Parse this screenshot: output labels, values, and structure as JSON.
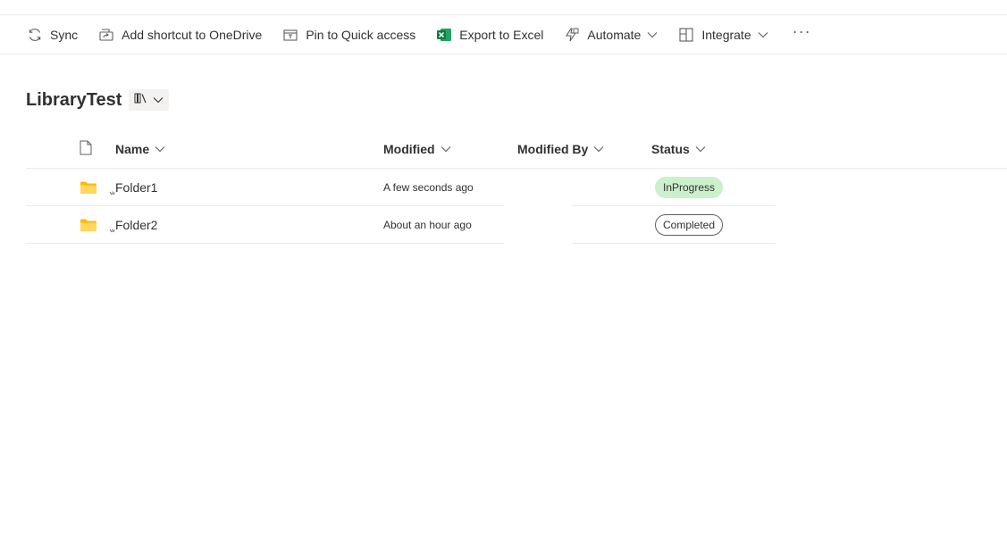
{
  "commandbar": {
    "sync": "Sync",
    "add_shortcut": "Add shortcut to OneDrive",
    "pin": "Pin to Quick access",
    "export": "Export to Excel",
    "automate": "Automate",
    "integrate": "Integrate",
    "more": "···"
  },
  "library": {
    "title": "LibraryTest"
  },
  "columns": {
    "name": "Name",
    "modified": "Modified",
    "modified_by": "Modified By",
    "status": "Status"
  },
  "rows": [
    {
      "name": "Folder1",
      "modified": "A few seconds ago",
      "modified_by": "",
      "status": "InProgress"
    },
    {
      "name": "Folder2",
      "modified": "About an hour ago",
      "modified_by": "",
      "status": "Completed"
    }
  ],
  "colors": {
    "excel_green": "#107c41",
    "folder_yellow": "#ffb900",
    "inprogress_bg": "#caf0cc"
  }
}
